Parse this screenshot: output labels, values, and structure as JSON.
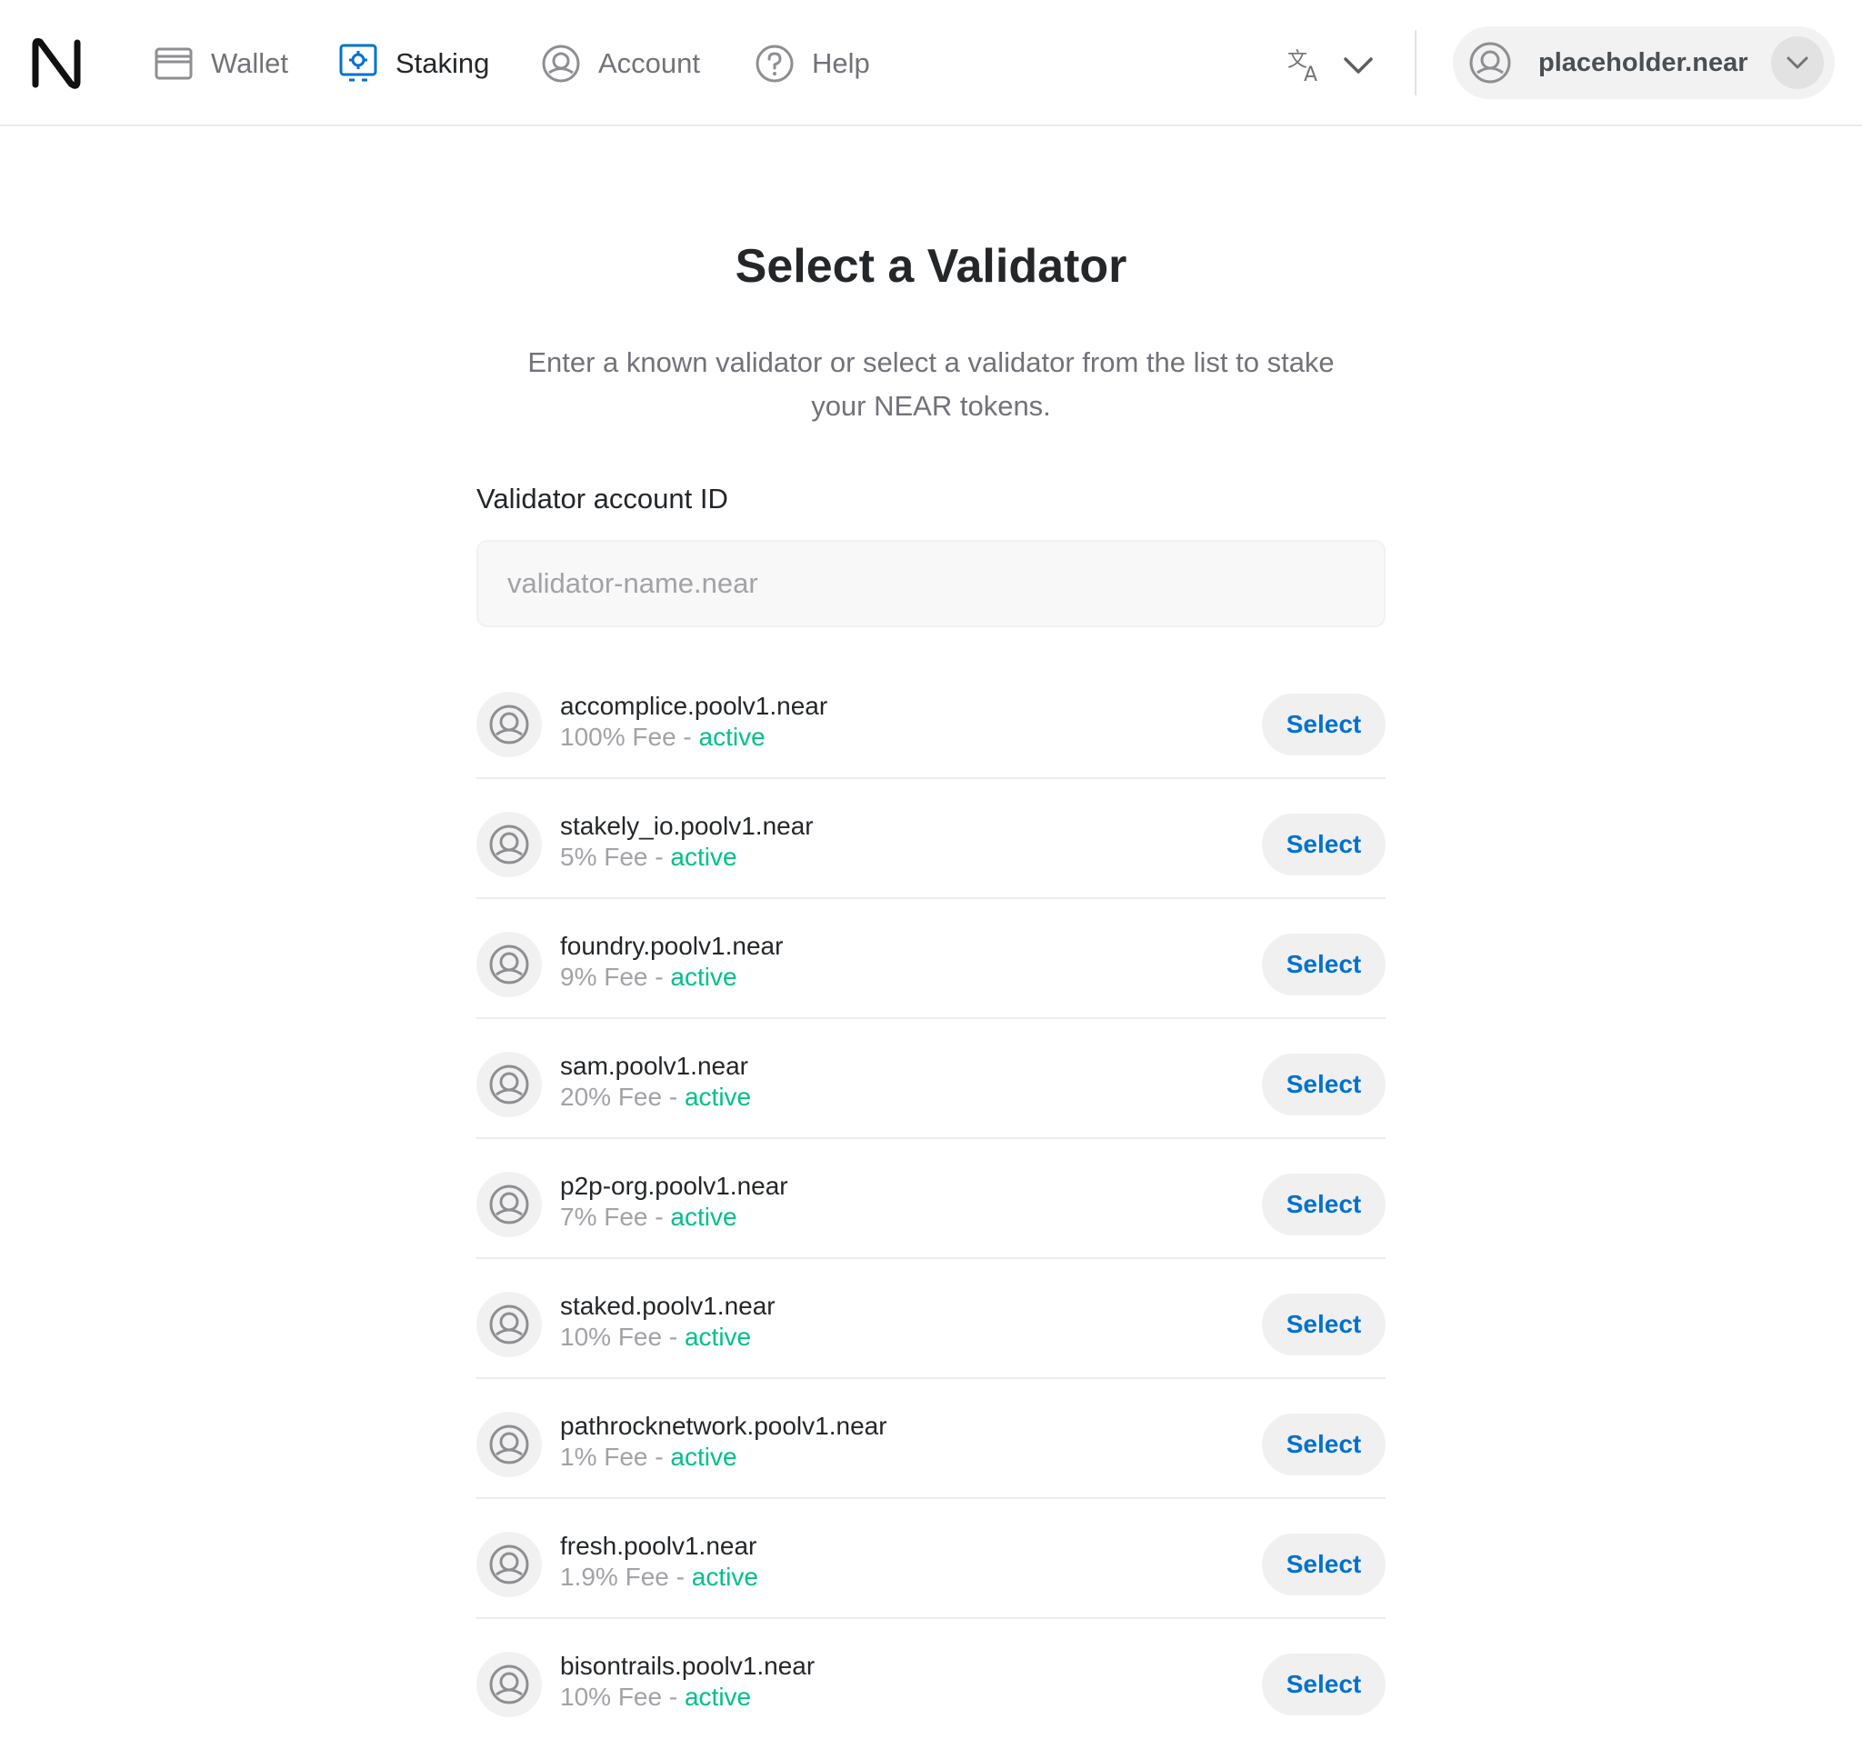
{
  "header": {
    "nav": [
      {
        "label": "Wallet",
        "icon": "wallet-icon"
      },
      {
        "label": "Staking",
        "icon": "staking-icon",
        "active": true
      },
      {
        "label": "Account",
        "icon": "account-icon"
      },
      {
        "label": "Help",
        "icon": "help-icon"
      }
    ],
    "language_icon": "translate-icon",
    "account_name": "placeholder.near"
  },
  "main": {
    "title": "Select a Validator",
    "subtitle_line1": "Enter a known validator or select a validator from the list to stake",
    "subtitle_line2": "your NEAR tokens.",
    "field_label": "Validator account ID",
    "input_placeholder": "validator-name.near",
    "input_value": "",
    "validators": [
      {
        "name": "accomplice.poolv1.near",
        "fee": "100% Fee",
        "status": "active",
        "button": "Select"
      },
      {
        "name": "stakely_io.poolv1.near",
        "fee": "5% Fee",
        "status": "active",
        "button": "Select"
      },
      {
        "name": "foundry.poolv1.near",
        "fee": "9% Fee",
        "status": "active",
        "button": "Select"
      },
      {
        "name": "sam.poolv1.near",
        "fee": "20% Fee",
        "status": "active",
        "button": "Select"
      },
      {
        "name": "p2p-org.poolv1.near",
        "fee": "7% Fee",
        "status": "active",
        "button": "Select"
      },
      {
        "name": "staked.poolv1.near",
        "fee": "10% Fee",
        "status": "active",
        "button": "Select"
      },
      {
        "name": "pathrocknetwork.poolv1.near",
        "fee": "1% Fee",
        "status": "active",
        "button": "Select"
      },
      {
        "name": "fresh.poolv1.near",
        "fee": "1.9% Fee",
        "status": "active",
        "button": "Select"
      },
      {
        "name": "bisontrails.poolv1.near",
        "fee": "10% Fee",
        "status": "active",
        "button": "Select"
      }
    ],
    "meta_separator": " - "
  },
  "colors": {
    "accent": "#0072ce",
    "active_status": "#00c08b",
    "muted_text": "#72727a"
  }
}
